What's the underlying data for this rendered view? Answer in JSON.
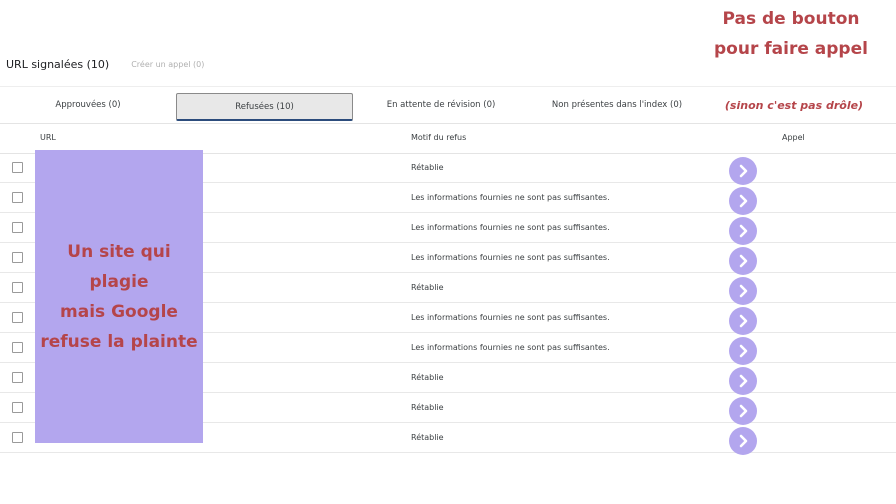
{
  "header": {
    "title": "URL signalées (10)",
    "create_appeal": "Créer un appel (0)"
  },
  "tabs": [
    {
      "label": "Approuvées (0)",
      "active": false
    },
    {
      "label": "Refusées (10)",
      "active": true
    },
    {
      "label": "En attente de révision (0)",
      "active": false
    },
    {
      "label": "Non présentes dans l'index (0)",
      "active": false
    }
  ],
  "columns": {
    "url": "URL",
    "motif": "Motif du refus",
    "appel": "Appel"
  },
  "rows": [
    {
      "motif": "Rétablie"
    },
    {
      "motif": "Les informations fournies ne sont pas suffisantes."
    },
    {
      "motif": "Les informations fournies ne sont pas suffisantes."
    },
    {
      "motif": "Les informations fournies ne sont pas suffisantes."
    },
    {
      "motif": "Rétablie"
    },
    {
      "motif": "Les informations fournies ne sont pas suffisantes."
    },
    {
      "motif": "Les informations fournies ne sont pas suffisantes."
    },
    {
      "motif": "Rétablie"
    },
    {
      "motif": "Rétablie"
    },
    {
      "motif": "Rétablie"
    }
  ],
  "annotations": {
    "mask_text": "Un site qui plagie\nmais Google\nrefuse la plainte",
    "no_button": "Pas de bouton\npour faire appel",
    "joke": "(sinon c'est pas drôle)"
  },
  "colors": {
    "annotation": "#b5454a",
    "mask": "#b3a6ee",
    "appeal_button": "#b3a6ee"
  },
  "icons": {
    "appeal": "chevron-right-icon"
  }
}
